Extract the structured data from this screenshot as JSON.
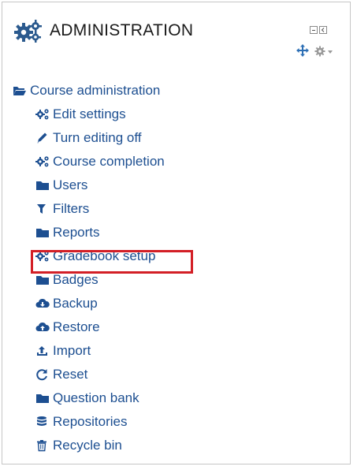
{
  "block": {
    "title": "ADMINISTRATION"
  },
  "tree": {
    "root": {
      "label": "Course administration",
      "icon": "folder-open-icon"
    },
    "items": [
      {
        "label": "Edit settings",
        "icon": "gears-icon"
      },
      {
        "label": "Turn editing off",
        "icon": "pencil-icon"
      },
      {
        "label": "Course completion",
        "icon": "gears-icon"
      },
      {
        "label": "Users",
        "icon": "folder-icon"
      },
      {
        "label": "Filters",
        "icon": "filter-icon"
      },
      {
        "label": "Reports",
        "icon": "folder-icon"
      },
      {
        "label": "Gradebook setup",
        "icon": "gears-icon",
        "highlighted": true
      },
      {
        "label": "Badges",
        "icon": "folder-icon"
      },
      {
        "label": "Backup",
        "icon": "cloud-download-icon"
      },
      {
        "label": "Restore",
        "icon": "cloud-upload-icon"
      },
      {
        "label": "Import",
        "icon": "upload-icon"
      },
      {
        "label": "Reset",
        "icon": "refresh-icon"
      },
      {
        "label": "Question bank",
        "icon": "folder-icon"
      },
      {
        "label": "Repositories",
        "icon": "database-icon"
      },
      {
        "label": "Recycle bin",
        "icon": "trash-icon"
      }
    ]
  },
  "colors": {
    "link": "#1d4f91",
    "icon": "#1d4f91",
    "highlight_border": "#d31f26",
    "header_icon": "#2b5a8e"
  }
}
